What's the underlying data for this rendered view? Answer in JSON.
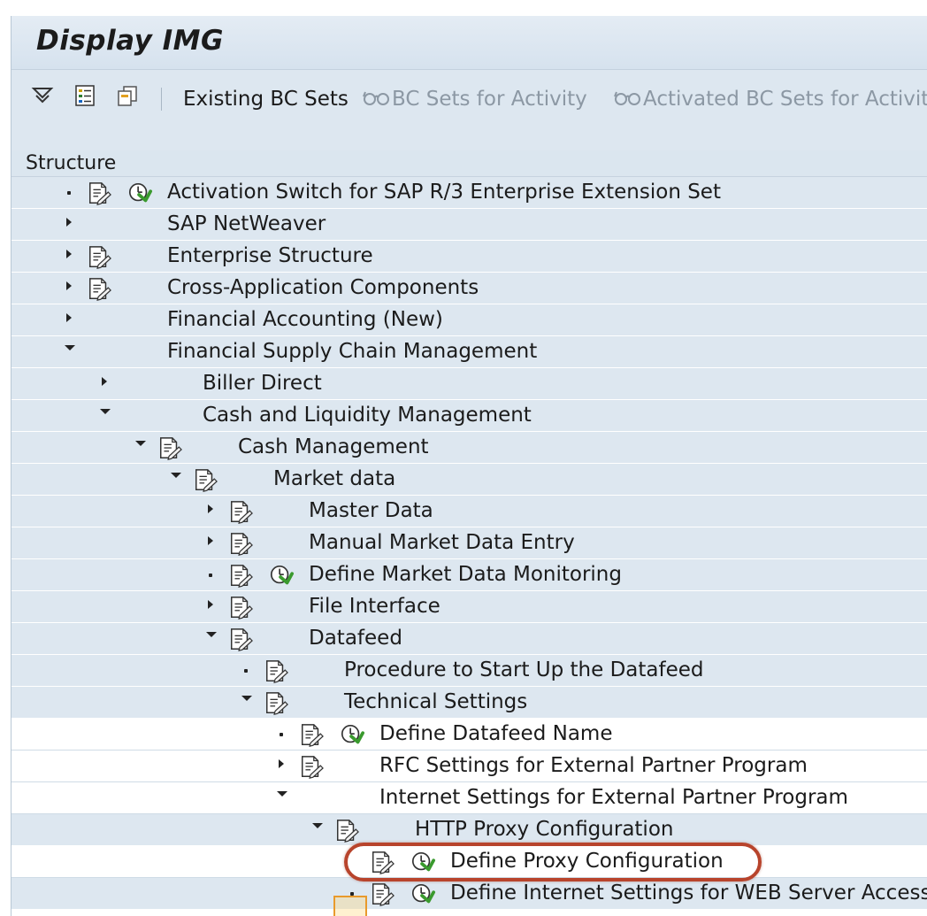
{
  "window": {
    "title": "Display IMG"
  },
  "toolbar": {
    "icons": [
      "funnel-down-icon",
      "checklist-icon",
      "copy-doc-icon"
    ],
    "existing_bc_sets": "Existing BC Sets",
    "bc_sets_for_activity": "BC Sets for Activity",
    "activated_bc_sets_for_activity": "Activated BC Sets for Activity"
  },
  "structure": {
    "header": "Structure",
    "rows": [
      {
        "label": "Activation Switch for SAP R/3 Enterprise Extension Set",
        "level": 0,
        "expander": "dot",
        "doc": true,
        "exec": true,
        "shade": "blue"
      },
      {
        "label": "SAP NetWeaver",
        "level": 0,
        "expander": "right",
        "doc": false,
        "exec": false,
        "shade": "blue"
      },
      {
        "label": "Enterprise Structure",
        "level": 0,
        "expander": "right",
        "doc": true,
        "exec": false,
        "shade": "blue"
      },
      {
        "label": "Cross-Application Components",
        "level": 0,
        "expander": "right",
        "doc": true,
        "exec": false,
        "shade": "blue"
      },
      {
        "label": "Financial Accounting (New)",
        "level": 0,
        "expander": "right",
        "doc": false,
        "exec": false,
        "shade": "blue"
      },
      {
        "label": "Financial Supply Chain Management",
        "level": 0,
        "expander": "down",
        "doc": false,
        "exec": false,
        "shade": "blue"
      },
      {
        "label": "Biller Direct",
        "level": 1,
        "expander": "right",
        "doc": false,
        "exec": false,
        "shade": "blue"
      },
      {
        "label": "Cash and Liquidity Management",
        "level": 1,
        "expander": "down",
        "doc": false,
        "exec": false,
        "shade": "blue"
      },
      {
        "label": "Cash Management",
        "level": 2,
        "expander": "down",
        "doc": true,
        "exec": false,
        "shade": "blue"
      },
      {
        "label": "Market data",
        "level": 3,
        "expander": "down",
        "doc": true,
        "exec": false,
        "shade": "blue"
      },
      {
        "label": "Master Data",
        "level": 4,
        "expander": "right",
        "doc": true,
        "exec": false,
        "shade": "blue"
      },
      {
        "label": "Manual Market Data Entry",
        "level": 4,
        "expander": "right",
        "doc": true,
        "exec": false,
        "shade": "blue"
      },
      {
        "label": "Define Market Data Monitoring",
        "level": 4,
        "expander": "dot",
        "doc": true,
        "exec": true,
        "shade": "blue"
      },
      {
        "label": "File Interface",
        "level": 4,
        "expander": "right",
        "doc": true,
        "exec": false,
        "shade": "blue"
      },
      {
        "label": "Datafeed",
        "level": 4,
        "expander": "down",
        "doc": true,
        "exec": false,
        "shade": "blue"
      },
      {
        "label": "Procedure to Start Up the Datafeed",
        "level": 5,
        "expander": "dot",
        "doc": true,
        "exec": false,
        "shade": "blue"
      },
      {
        "label": "Technical Settings",
        "level": 5,
        "expander": "down",
        "doc": true,
        "exec": false,
        "shade": "blue"
      },
      {
        "label": "Define Datafeed Name",
        "level": 6,
        "expander": "dot",
        "doc": true,
        "exec": true,
        "shade": "light"
      },
      {
        "label": "RFC Settings for External Partner Program",
        "level": 6,
        "expander": "right",
        "doc": true,
        "exec": false,
        "shade": "light"
      },
      {
        "label": "Internet Settings for External Partner Program",
        "level": 6,
        "expander": "down",
        "doc": false,
        "exec": false,
        "shade": "light"
      },
      {
        "label": "HTTP Proxy Configuration",
        "level": 7,
        "expander": "down",
        "doc": true,
        "exec": false,
        "shade": "blue"
      },
      {
        "label": "Define Proxy Configuration",
        "level": 8,
        "expander": "none",
        "doc": true,
        "exec": true,
        "shade": "light"
      },
      {
        "label": "Define Internet Settings for WEB Server Access",
        "level": 8,
        "expander": "dot",
        "doc": true,
        "exec": true,
        "shade": "blue"
      }
    ]
  },
  "colors": {
    "background": "#dde7f0",
    "row_light": "#ffffff",
    "highlight_ring": "#b8442c",
    "exec_icon_green": "#3a9a2e"
  }
}
